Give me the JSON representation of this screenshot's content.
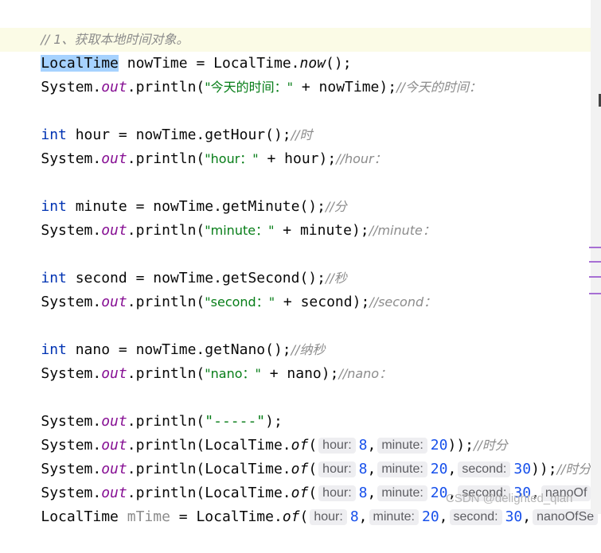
{
  "code": {
    "comment_1": "// 1、获取本地时间对象。",
    "line_localtime": {
      "type": "LocalTime",
      "var": "nowTime",
      "eq": " = ",
      "cls": "LocalTime",
      "dot": ".",
      "method": "now",
      "end": "();"
    },
    "print_now": {
      "pre": "System.",
      "out": "out",
      "mid": ".println(",
      "str": "\"今天的时间：\"",
      "rest": " + nowTime);",
      "comment": "//今天的时间："
    },
    "hour_decl": {
      "kw": "int",
      "rest": " hour = nowTime.getHour();",
      "comment": "//时"
    },
    "hour_print": {
      "pre": "System.",
      "out": "out",
      "mid": ".println(",
      "str": "\"hour：\"",
      "rest": " + hour);",
      "comment": "//hour："
    },
    "minute_decl": {
      "kw": "int",
      "rest": " minute = nowTime.getMinute();",
      "comment": "//分"
    },
    "minute_print": {
      "pre": "System.",
      "out": "out",
      "mid": ".println(",
      "str": "\"minute：\"",
      "rest": " + minute);",
      "comment": "//minute："
    },
    "second_decl": {
      "kw": "int",
      "rest": " second = nowTime.getSecond();",
      "comment": "//秒"
    },
    "second_print": {
      "pre": "System.",
      "out": "out",
      "mid": ".println(",
      "str": "\"second：\"",
      "rest": " + second);",
      "comment": "//second："
    },
    "nano_decl": {
      "kw": "int",
      "rest": " nano = nowTime.getNano();",
      "comment": "//纳秒"
    },
    "nano_print": {
      "pre": "System.",
      "out": "out",
      "mid": ".println(",
      "str": "\"nano：\"",
      "rest": " + nano);",
      "comment": "//nano："
    },
    "dash_print": {
      "pre": "System.",
      "out": "out",
      "mid": ".println(",
      "str": "\"-----\"",
      "rest": ");"
    },
    "of1": {
      "pre": "System.",
      "out": "out",
      "mid": ".println(LocalTime.",
      "method": "of",
      "open": "(",
      "hint_hour": "hour:",
      "v_hour": "8",
      "sep1": ",",
      "hint_minute": "minute:",
      "v_minute": "20",
      "end": "));",
      "comment": "//时分"
    },
    "of2": {
      "pre": "System.",
      "out": "out",
      "mid": ".println(LocalTime.",
      "method": "of",
      "open": "(",
      "hint_hour": "hour:",
      "v_hour": "8",
      "sep1": ",",
      "hint_minute": "minute:",
      "v_minute": "20",
      "sep2": ",",
      "hint_second": "second:",
      "v_second": "30",
      "end": "));",
      "comment": "//时分"
    },
    "of3": {
      "pre": "System.",
      "out": "out",
      "mid": ".println(LocalTime.",
      "method": "of",
      "open": "(",
      "hint_hour": "hour:",
      "v_hour": "8",
      "sep1": ",",
      "hint_minute": "minute:",
      "v_minute": "20",
      "sep2": ",",
      "hint_second": "second:",
      "v_second": "30",
      "sep3": ",",
      "hint_nano": "nanoOf"
    },
    "mtime": {
      "type": "LocalTime",
      "var": "mTime",
      "eq": " = LocalTime.",
      "method": "of",
      "open": "(",
      "hint_hour": "hour:",
      "v_hour": "8",
      "sep1": ",",
      "hint_minute": "minute:",
      "v_minute": "20",
      "sep2": ",",
      "hint_second": "second:",
      "v_second": "30",
      "sep3": ",",
      "hint_nano": "nanoOfSe"
    }
  },
  "watermark": "CSDN @delighted_qian",
  "colors": {
    "keyword": "#0033b3",
    "string": "#067d17",
    "number": "#1750eb",
    "field": "#871094",
    "comment": "#8c8c8c",
    "selection": "#a6d2ff"
  }
}
